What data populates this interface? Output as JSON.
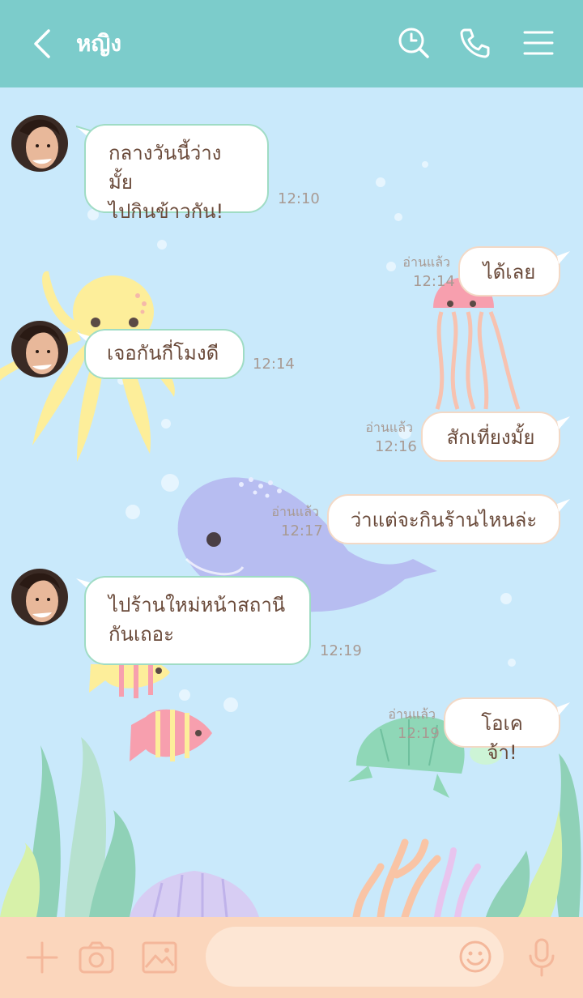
{
  "header": {
    "title": "หญิง",
    "icons": [
      "back-icon",
      "clock-search-icon",
      "phone-icon",
      "menu-icon"
    ]
  },
  "messages": [
    {
      "side": "in",
      "lines": [
        "กลางวันนี้ว่างมั้ย",
        "ไปกินข้าวกัน!"
      ],
      "time": "12:10"
    },
    {
      "side": "out",
      "text": "ได้เลย",
      "read": "อ่านแล้ว",
      "time": "12:14"
    },
    {
      "side": "in",
      "text": "เจอกันกี่โมงดี",
      "time": "12:14"
    },
    {
      "side": "out",
      "text": "สักเที่ยงมั้ย",
      "read": "อ่านแล้ว",
      "time": "12:16"
    },
    {
      "side": "out",
      "text": "ว่าแต่จะกินร้านไหนล่ะ",
      "read": "อ่านแล้ว",
      "time": "12:17"
    },
    {
      "side": "in",
      "lines": [
        "ไปร้านใหม่หน้าสถานี",
        "กันเถอะ"
      ],
      "time": "12:19"
    },
    {
      "side": "out",
      "text": "โอเคจ้า!",
      "read": "อ่านแล้ว",
      "time": "12:19"
    }
  ],
  "footer": {
    "icons": [
      "plus-icon",
      "camera-icon",
      "image-icon",
      "emoji-icon",
      "microphone-icon"
    ],
    "input_placeholder": ""
  },
  "colors": {
    "header": "#7ccccb",
    "background": "#c9e9fb",
    "footer": "#fbd6bc",
    "text": "#6a4a3a"
  }
}
